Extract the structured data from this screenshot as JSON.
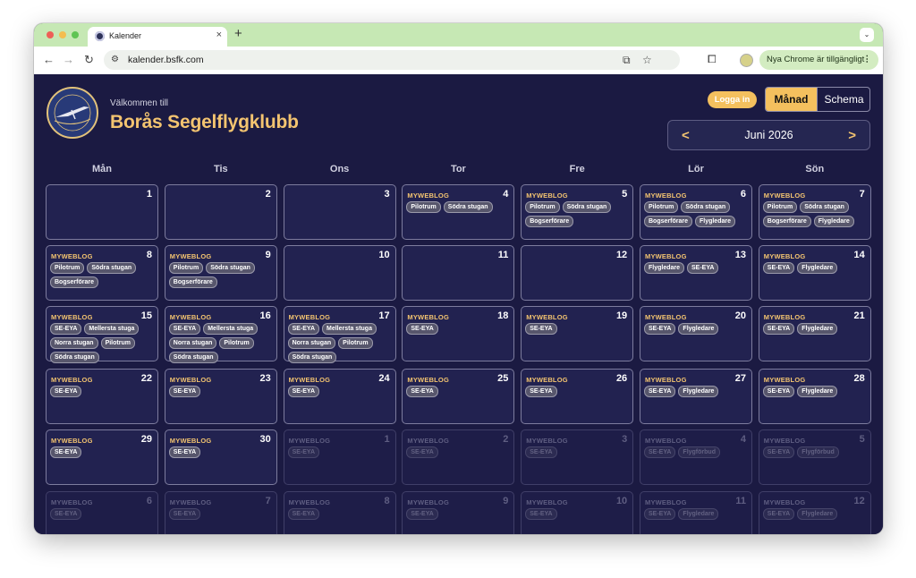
{
  "browser": {
    "tab_title": "Kalender",
    "url": "kalender.bsfk.com",
    "update_label": "Nya Chrome är tillgängligt"
  },
  "header": {
    "logo_text": "BSFK",
    "welcome": "Välkommen till",
    "club_name": "Borås Segelflygklubb",
    "login_label": "Logga in",
    "view_month": "Månad",
    "view_schema": "Schema",
    "nav_prev": "<",
    "nav_next": ">",
    "current_month": "Juni 2026"
  },
  "weekdays": [
    "Mån",
    "Tis",
    "Ons",
    "Tor",
    "Fre",
    "Lör",
    "Sön"
  ],
  "days": [
    {
      "day": "1",
      "title": "",
      "tags": [],
      "current": true
    },
    {
      "day": "2",
      "title": "",
      "tags": [],
      "current": true
    },
    {
      "day": "3",
      "title": "",
      "tags": [],
      "current": true
    },
    {
      "day": "4",
      "title": "MYWEBLOG",
      "tags": [
        "Pilotrum",
        "Södra stugan"
      ],
      "current": true
    },
    {
      "day": "5",
      "title": "MYWEBLOG",
      "tags": [
        "Pilotrum",
        "Södra stugan",
        "Bogserförare"
      ],
      "current": true
    },
    {
      "day": "6",
      "title": "MYWEBLOG",
      "tags": [
        "Pilotrum",
        "Södra stugan",
        "Bogserförare",
        "Flygledare"
      ],
      "current": true
    },
    {
      "day": "7",
      "title": "MYWEBLOG",
      "tags": [
        "Pilotrum",
        "Södra stugan",
        "Bogserförare",
        "Flygledare"
      ],
      "current": true
    },
    {
      "day": "8",
      "title": "MYWEBLOG",
      "tags": [
        "Pilotrum",
        "Södra stugan",
        "Bogserförare"
      ],
      "current": true
    },
    {
      "day": "9",
      "title": "MYWEBLOG",
      "tags": [
        "Pilotrum",
        "Södra stugan",
        "Bogserförare"
      ],
      "current": true
    },
    {
      "day": "10",
      "title": "",
      "tags": [],
      "current": true
    },
    {
      "day": "11",
      "title": "",
      "tags": [],
      "current": true
    },
    {
      "day": "12",
      "title": "",
      "tags": [],
      "current": true
    },
    {
      "day": "13",
      "title": "MYWEBLOG",
      "tags": [
        "Flygledare",
        "SE-EYA"
      ],
      "current": true
    },
    {
      "day": "14",
      "title": "MYWEBLOG",
      "tags": [
        "SE-EYA",
        "Flygledare"
      ],
      "current": true
    },
    {
      "day": "15",
      "title": "MYWEBLOG",
      "tags": [
        "SE-EYA",
        "Mellersta stuga",
        "Norra stugan",
        "Pilotrum",
        "Södra stugan"
      ],
      "current": true
    },
    {
      "day": "16",
      "title": "MYWEBLOG",
      "tags": [
        "SE-EYA",
        "Mellersta stuga",
        "Norra stugan",
        "Pilotrum",
        "Södra stugan"
      ],
      "current": true
    },
    {
      "day": "17",
      "title": "MYWEBLOG",
      "tags": [
        "SE-EYA",
        "Mellersta stuga",
        "Norra stugan",
        "Pilotrum",
        "Södra stugan"
      ],
      "current": true
    },
    {
      "day": "18",
      "title": "MYWEBLOG",
      "tags": [
        "SE-EYA"
      ],
      "current": true
    },
    {
      "day": "19",
      "title": "MYWEBLOG",
      "tags": [
        "SE-EYA"
      ],
      "current": true
    },
    {
      "day": "20",
      "title": "MYWEBLOG",
      "tags": [
        "SE-EYA",
        "Flygledare"
      ],
      "current": true
    },
    {
      "day": "21",
      "title": "MYWEBLOG",
      "tags": [
        "SE-EYA",
        "Flygledare"
      ],
      "current": true
    },
    {
      "day": "22",
      "title": "MYWEBLOG",
      "tags": [
        "SE-EYA"
      ],
      "current": true
    },
    {
      "day": "23",
      "title": "MYWEBLOG",
      "tags": [
        "SE-EYA"
      ],
      "current": true
    },
    {
      "day": "24",
      "title": "MYWEBLOG",
      "tags": [
        "SE-EYA"
      ],
      "current": true
    },
    {
      "day": "25",
      "title": "MYWEBLOG",
      "tags": [
        "SE-EYA"
      ],
      "current": true
    },
    {
      "day": "26",
      "title": "MYWEBLOG",
      "tags": [
        "SE-EYA"
      ],
      "current": true
    },
    {
      "day": "27",
      "title": "MYWEBLOG",
      "tags": [
        "SE-EYA",
        "Flygledare"
      ],
      "current": true
    },
    {
      "day": "28",
      "title": "MYWEBLOG",
      "tags": [
        "SE-EYA",
        "Flygledare"
      ],
      "current": true
    },
    {
      "day": "29",
      "title": "MYWEBLOG",
      "tags": [
        "SE-EYA"
      ],
      "current": true
    },
    {
      "day": "30",
      "title": "MYWEBLOG",
      "tags": [
        "SE-EYA"
      ],
      "current": true
    },
    {
      "day": "1",
      "title": "MYWEBLOG",
      "tags": [
        "SE-EYA"
      ],
      "current": false
    },
    {
      "day": "2",
      "title": "MYWEBLOG",
      "tags": [
        "SE-EYA"
      ],
      "current": false
    },
    {
      "day": "3",
      "title": "MYWEBLOG",
      "tags": [
        "SE-EYA"
      ],
      "current": false
    },
    {
      "day": "4",
      "title": "MYWEBLOG",
      "tags": [
        "SE-EYA",
        "Flygförbud"
      ],
      "current": false
    },
    {
      "day": "5",
      "title": "MYWEBLOG",
      "tags": [
        "SE-EYA",
        "Flygförbud"
      ],
      "current": false
    },
    {
      "day": "6",
      "title": "MYWEBLOG",
      "tags": [
        "SE-EYA"
      ],
      "current": false
    },
    {
      "day": "7",
      "title": "MYWEBLOG",
      "tags": [
        "SE-EYA"
      ],
      "current": false
    },
    {
      "day": "8",
      "title": "MYWEBLOG",
      "tags": [
        "SE-EYA"
      ],
      "current": false
    },
    {
      "day": "9",
      "title": "MYWEBLOG",
      "tags": [
        "SE-EYA"
      ],
      "current": false
    },
    {
      "day": "10",
      "title": "MYWEBLOG",
      "tags": [
        "SE-EYA"
      ],
      "current": false
    },
    {
      "day": "11",
      "title": "MYWEBLOG",
      "tags": [
        "SE-EYA",
        "Flygledare"
      ],
      "current": false
    },
    {
      "day": "12",
      "title": "MYWEBLOG",
      "tags": [
        "SE-EYA",
        "Flygledare"
      ],
      "current": false
    }
  ]
}
